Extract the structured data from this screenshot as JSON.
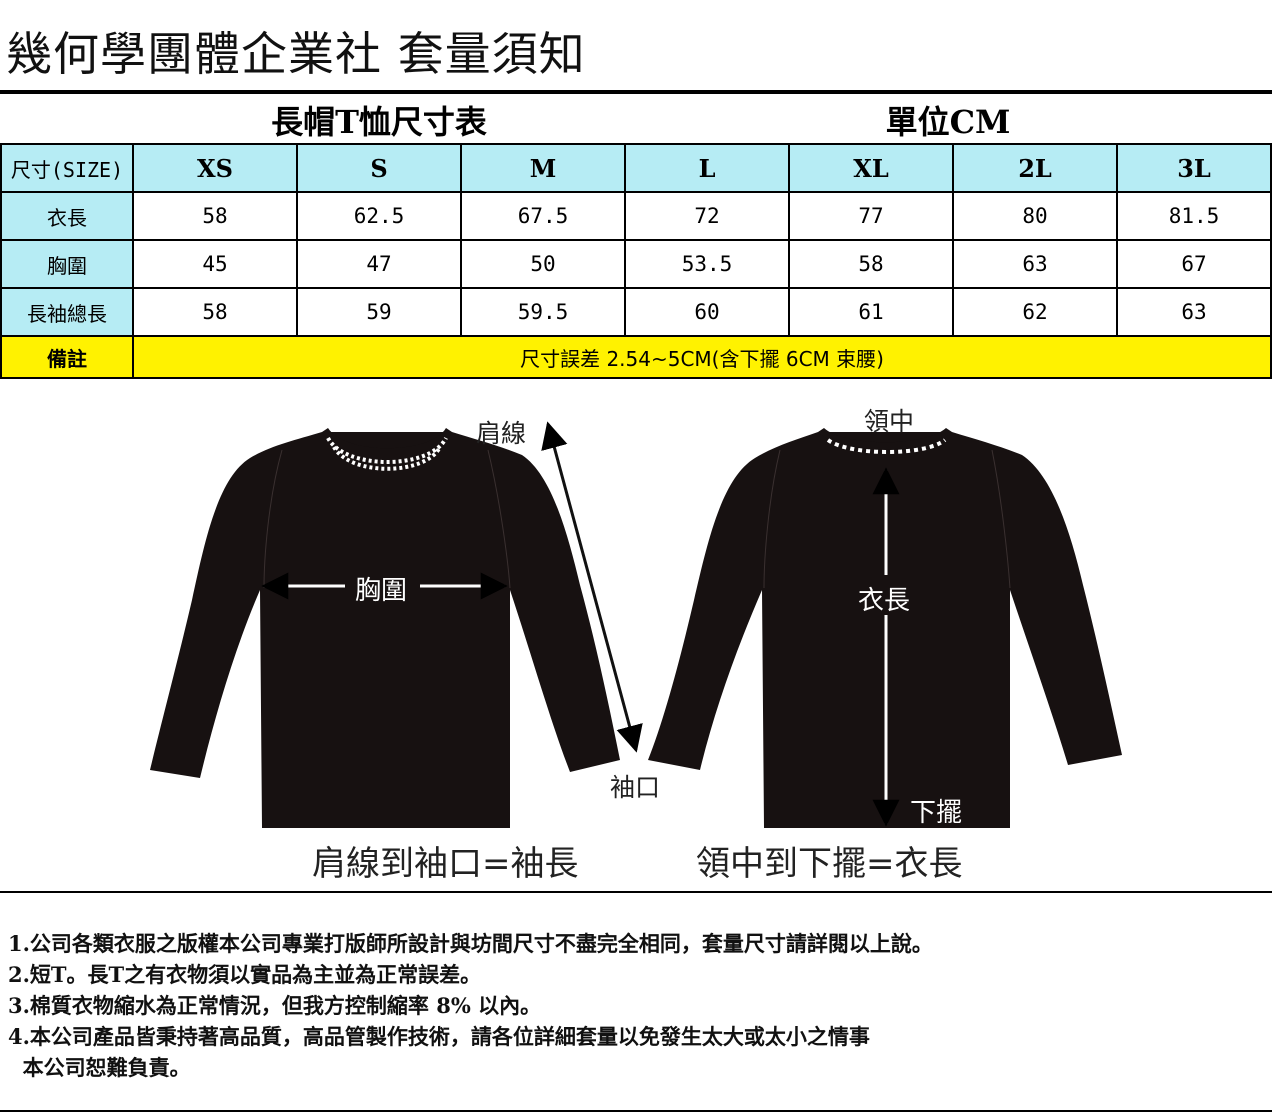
{
  "title": "幾何學團體企業社  套量須知",
  "table": {
    "heading_left": "長帽T恤尺寸表",
    "heading_right": "單位CM",
    "size_label": "尺寸(SIZE)",
    "sizes": [
      "XS",
      "S",
      "M",
      "L",
      "XL",
      "2L",
      "3L"
    ],
    "rows": [
      {
        "label": "衣長",
        "values": [
          "58",
          "62.5",
          "67.5",
          "72",
          "77",
          "80",
          "81.5"
        ]
      },
      {
        "label": "胸圍",
        "values": [
          "45",
          "47",
          "50",
          "53.5",
          "58",
          "63",
          "67"
        ]
      },
      {
        "label": "長袖總長",
        "values": [
          "58",
          "59",
          "59.5",
          "60",
          "61",
          "62",
          "63"
        ]
      }
    ],
    "remark_label": "備註",
    "remark_value": "尺寸誤差 2.54~5CM(含下擺 6CM 束腰)",
    "colors": {
      "header_bg": "#b6ecf4",
      "remark_bg": "#fff200"
    }
  },
  "diagram": {
    "shoulder": "肩線",
    "cuff": "袖口",
    "chest": "胸圍",
    "neck_center": "領中",
    "body_length": "衣長",
    "hem": "下擺",
    "caption_left": "肩線到袖口=袖長",
    "caption_right": "領中到下擺=衣長",
    "garment_color": "#171111"
  },
  "notes": [
    "1.公司各類衣服之版權本公司專業打版師所設計與坊間尺寸不盡完全相同，套量尺寸請詳閱以上說。",
    "2.短T。長T之有衣物須以實品為主並為正常誤差。",
    "3.棉質衣物縮水為正常情況，但我方控制縮率 8% 以內。",
    "4.本公司產品皆秉持著高品質，高品管製作技術，請各位詳細套量以免發生太大或太小之情事",
    "  本公司恕難負責。"
  ]
}
